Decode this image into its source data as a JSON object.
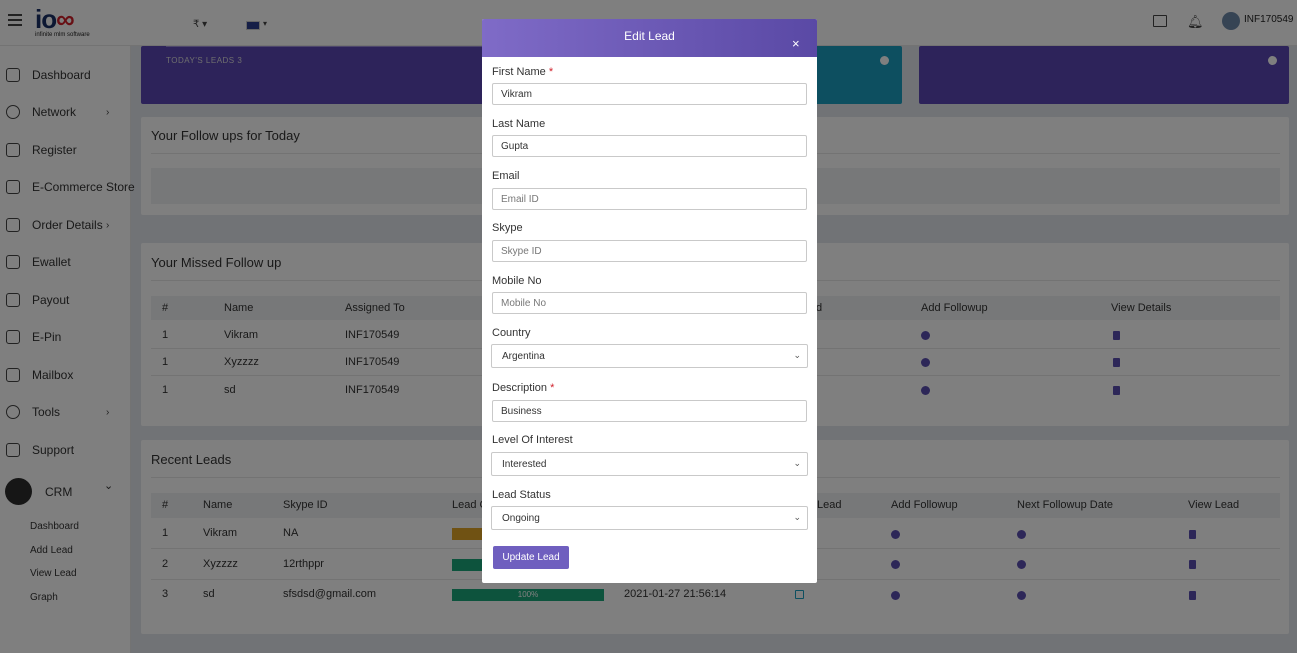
{
  "header": {
    "logo_text_a": "io",
    "logo_text_b": "∞",
    "logo_sub": "infinite mlm software",
    "currency": "₹ ▾",
    "flag_caret": "▾",
    "username": "INF170549"
  },
  "sidebar": {
    "items": [
      {
        "label": "Dashboard"
      },
      {
        "label": "Network",
        "arrow": "›"
      },
      {
        "label": "Register"
      },
      {
        "label": "E-Commerce Store"
      },
      {
        "label": "Order Details",
        "arrow": "›"
      },
      {
        "label": "Ewallet"
      },
      {
        "label": "Payout"
      },
      {
        "label": "E-Pin"
      },
      {
        "label": "Mailbox"
      },
      {
        "label": "Tools",
        "arrow": "›"
      },
      {
        "label": "Support"
      }
    ],
    "crm": {
      "label": "CRM",
      "arrow": "⌄"
    },
    "sub_items": [
      {
        "label": "Dashboard"
      },
      {
        "label": "Add Lead"
      },
      {
        "label": "View Lead"
      },
      {
        "label": "Graph"
      }
    ]
  },
  "top_cards": {
    "today_leads": "TODAY'S LEADS 3",
    "arrow": "›"
  },
  "followups_today": {
    "title": "Your Follow ups for Today"
  },
  "missed_followup": {
    "title": "Your Missed Follow up",
    "headers": [
      "#",
      "Name",
      "Assigned To",
      "d",
      "Add Followup",
      "View Details"
    ],
    "rows": [
      {
        "num": "1",
        "name": "Vikram",
        "assigned": "INF170549"
      },
      {
        "num": "1",
        "name": "Xyzzzz",
        "assigned": "INF170549"
      },
      {
        "num": "1",
        "name": "sd",
        "assigned": "INF170549"
      }
    ]
  },
  "recent_leads": {
    "title": "Recent Leads",
    "headers": [
      "#",
      "Name",
      "Skype ID",
      "Lead C",
      "Lead",
      "Add Followup",
      "Next Followup Date",
      "View Lead"
    ],
    "rows": [
      {
        "num": "1",
        "name": "Vikram",
        "skype": "NA",
        "bar_color": "#e0a526",
        "progress": "",
        "date": ""
      },
      {
        "num": "2",
        "name": "Xyzzzz",
        "skype": "12rthppr",
        "bar_color": "#1aa67a",
        "progress": "",
        "date": ""
      },
      {
        "num": "3",
        "name": "sd",
        "skype": "sfsdsd@gmail.com",
        "bar_color": "#1aa67a",
        "progress": "100%",
        "date": "2021-01-27 21:56:14"
      }
    ]
  },
  "modal": {
    "title": "Edit Lead",
    "close": "×",
    "first_name_label": "First Name",
    "first_name_value": "Vikram",
    "last_name_label": "Last Name",
    "last_name_value": "Gupta",
    "email_label": "Email",
    "email_placeholder": "Email ID",
    "skype_label": "Skype",
    "skype_placeholder": "Skype ID",
    "mobile_label": "Mobile No",
    "mobile_placeholder": "Mobile No",
    "country_label": "Country",
    "country_value": "Argentina",
    "description_label": "Description",
    "description_value": "Business",
    "interest_label": "Level Of Interest",
    "interest_value": "Interested",
    "status_label": "Lead Status",
    "status_value": "Ongoing",
    "required_mark": "*",
    "caret": "⌄",
    "submit_label": "Update Lead"
  },
  "colors": {
    "purple_card": "#5b47b5",
    "teal_card": "#1a9fc0",
    "accent": "#6f5fbf"
  }
}
